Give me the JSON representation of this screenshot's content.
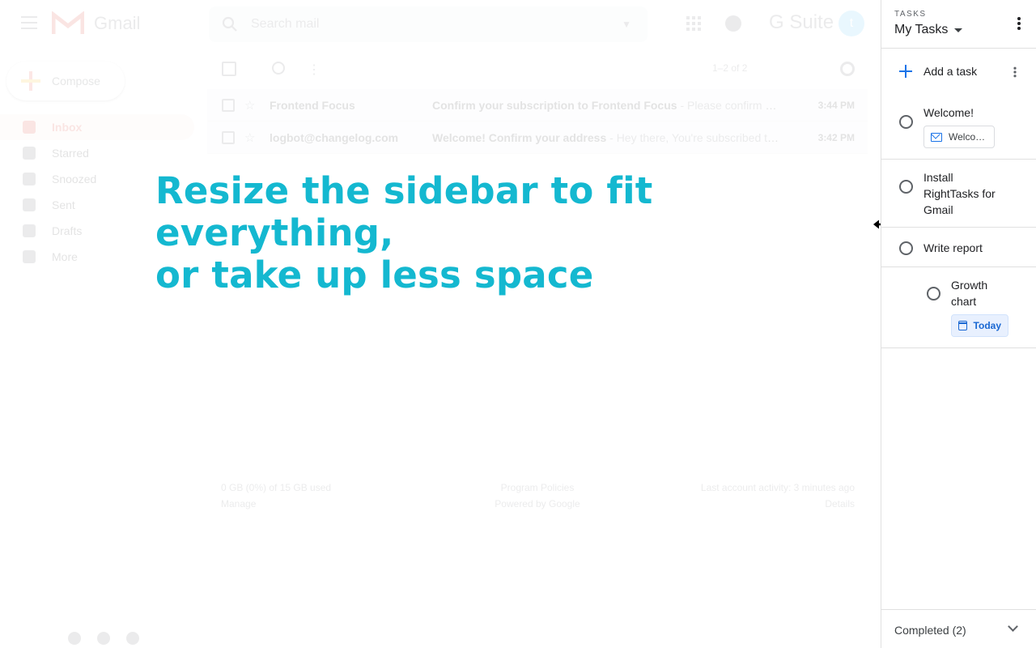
{
  "gmail": {
    "brand": "Gmail",
    "search_placeholder": "Search mail",
    "suite_label": "G Suite",
    "avatar_initial": "t",
    "compose_label": "Compose",
    "nav": [
      {
        "label": "Inbox",
        "active": true
      },
      {
        "label": "Starred"
      },
      {
        "label": "Snoozed"
      },
      {
        "label": "Sent"
      },
      {
        "label": "Drafts"
      },
      {
        "label": "More"
      }
    ],
    "toolbar": {
      "range": "1–2 of 2"
    },
    "emails": [
      {
        "from": "Frontend Focus",
        "subject": "Confirm your subscription to Frontend Focus",
        "snippet": " - Please confirm yo…",
        "time": "3:44 PM"
      },
      {
        "from": "logbot@changelog.com",
        "subject": "Welcome! Confirm your address",
        "snippet": " - Hey there, You're subscribed to…",
        "time": "3:42 PM"
      }
    ],
    "footer": {
      "storage": "0 GB (0%) of 15 GB used",
      "manage": "Manage",
      "policies": "Program Policies",
      "powered": "Powered by Google",
      "activity": "Last account activity: 3 minutes ago",
      "details": "Details"
    }
  },
  "caption": {
    "line1": "Resize the sidebar to fit everything,",
    "line2": "or take up less space"
  },
  "tasks": {
    "kicker": "TASKS",
    "list_name": "My Tasks",
    "add_label": "Add a task",
    "items": [
      {
        "title": "Welcome!",
        "chip": "Welco…"
      },
      {
        "title_lines": [
          "Install",
          "RightTasks for",
          "Gmail"
        ]
      },
      {
        "title": "Write report"
      },
      {
        "title_lines": [
          "Growth",
          "chart"
        ],
        "chip": "Today"
      }
    ],
    "completed_label": "Completed (2)"
  },
  "colors": {
    "caption": "#14b8d0",
    "accent_blue": "#1a73e8"
  }
}
